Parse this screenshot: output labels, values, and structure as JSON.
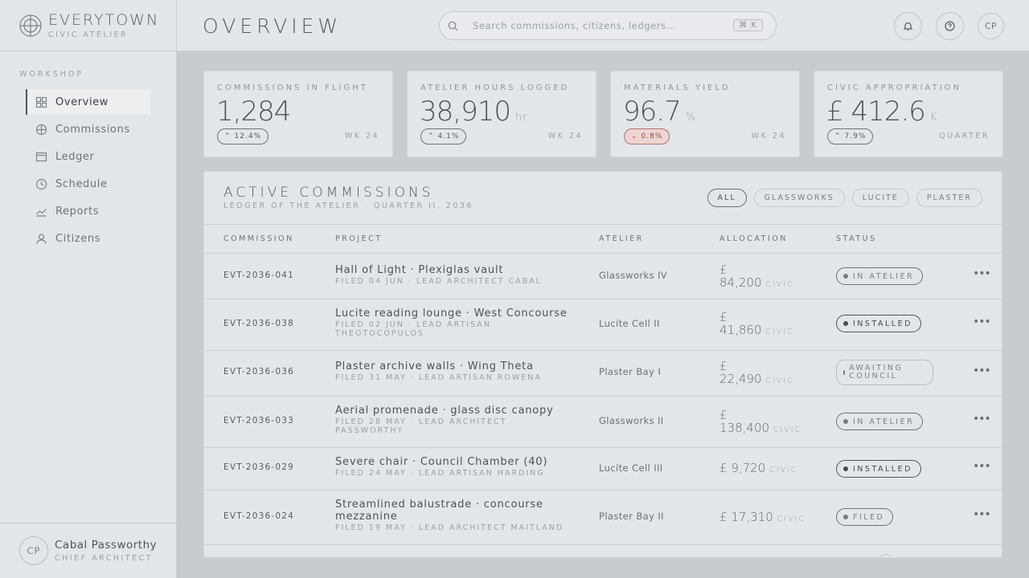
{
  "brand": {
    "name": "EVERYTOWN",
    "subtitle": "CIVIC ATELIER"
  },
  "nav": {
    "section": "WORKSHOP",
    "items": [
      {
        "label": "Overview",
        "icon": "grid-icon",
        "active": true
      },
      {
        "label": "Commissions",
        "icon": "globe-icon"
      },
      {
        "label": "Ledger",
        "icon": "ledger-icon"
      },
      {
        "label": "Schedule",
        "icon": "clock-icon"
      },
      {
        "label": "Reports",
        "icon": "trend-icon"
      },
      {
        "label": "Citizens",
        "icon": "person-icon"
      }
    ]
  },
  "user": {
    "initials": "CP",
    "name": "Cabal Passworthy",
    "role": "CHIEF ARCHITECT"
  },
  "header": {
    "title": "OVERVIEW",
    "search_placeholder": "Search commissions, citizens, ledgers…",
    "shortcut": "⌘ K",
    "avatar_initials": "CP"
  },
  "kpis": [
    {
      "label": "COMMISSIONS IN FLIGHT",
      "value": "1,284",
      "unit": "",
      "change": "12.4%",
      "direction": "up",
      "period": "WK 24"
    },
    {
      "label": "ATELIER HOURS LOGGED",
      "value": "38,910",
      "unit": "hr",
      "change": "4.1%",
      "direction": "up",
      "period": "WK 24"
    },
    {
      "label": "MATERIALS YIELD",
      "value": "96.7",
      "unit": "%",
      "change": "0.8%",
      "direction": "down",
      "period": "WK 24"
    },
    {
      "label": "CIVIC APPROPRIATION",
      "value": "£ 412.6",
      "unit": "K",
      "change": "7.9%",
      "direction": "up",
      "period": "QUARTER"
    }
  ],
  "panel": {
    "title": "ACTIVE COMMISSIONS",
    "subtitle": "LEDGER OF THE ATELIER · QUARTER II, 2036",
    "filters": [
      "ALL",
      "GLASSWORKS",
      "LUCITE",
      "PLASTER"
    ],
    "active_filter": "ALL",
    "columns": [
      "COMMISSION",
      "PROJECT",
      "ATELIER",
      "ALLOCATION",
      "STATUS"
    ],
    "rows": [
      {
        "id": "EVT-2036-041",
        "project": "Hall of Light · Plexiglas vault",
        "meta": "FILED 04 JUN · LEAD ARCHITECT CABAL",
        "atelier": "Glassworks IV",
        "alloc_currency": "£",
        "alloc_amount": "84,200",
        "alloc_unit": "CIVIC",
        "status": "IN ATELIER"
      },
      {
        "id": "EVT-2036-038",
        "project": "Lucite reading lounge · West Concourse",
        "meta": "FILED 02 JUN · LEAD ARTISAN THEOTOCOPULOS",
        "atelier": "Lucite Cell II",
        "alloc_currency": "£",
        "alloc_amount": "41,860",
        "alloc_unit": "CIVIC",
        "status": "INSTALLED"
      },
      {
        "id": "EVT-2036-036",
        "project": "Plaster archive walls · Wing Theta",
        "meta": "FILED 31 MAY · LEAD ARTISAN ROWENA",
        "atelier": "Plaster Bay I",
        "alloc_currency": "£",
        "alloc_amount": "22,490",
        "alloc_unit": "CIVIC",
        "status": "AWAITING COUNCIL"
      },
      {
        "id": "EVT-2036-033",
        "project": "Aerial promenade · glass disc canopy",
        "meta": "FILED 28 MAY · LEAD ARCHITECT PASSWORTHY",
        "atelier": "Glassworks II",
        "alloc_currency": "£",
        "alloc_amount": "138,400",
        "alloc_unit": "CIVIC",
        "status": "IN ATELIER"
      },
      {
        "id": "EVT-2036-029",
        "project": "Severe chair · Council Chamber (40)",
        "meta": "FILED 24 MAY · LEAD ARTISAN HARDING",
        "atelier": "Lucite Cell III",
        "alloc_currency": "£",
        "alloc_amount": "9,720",
        "alloc_unit": "CIVIC",
        "status": "INSTALLED"
      },
      {
        "id": "EVT-2036-024",
        "project": "Streamlined balustrade · concourse mezzanine",
        "meta": "FILED 19 MAY · LEAD ARCHITECT MAITLAND",
        "atelier": "Plaster Bay II",
        "alloc_currency": "£",
        "alloc_amount": "17,310",
        "alloc_unit": "CIVIC",
        "status": "FILED"
      }
    ]
  }
}
